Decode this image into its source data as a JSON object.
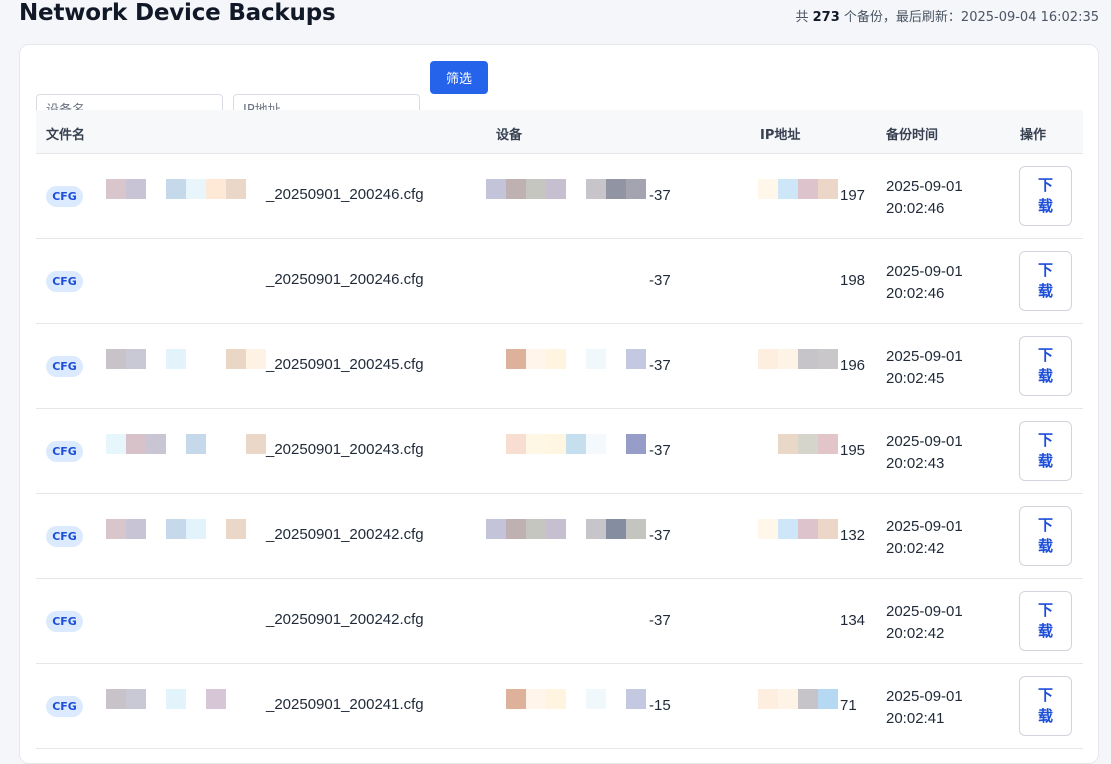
{
  "header": {
    "title": "Network Device Backups",
    "meta_prefix": "共",
    "total": "273",
    "meta_middle": "个备份，最后刷新：",
    "refreshed": "2025-09-04 16:02:35"
  },
  "filters": {
    "device_placeholder": "设备名",
    "ip_placeholder": "IP地址",
    "button_label": "筛选"
  },
  "table": {
    "columns": [
      "文件名",
      "设备",
      "IP地址",
      "备份时间",
      "操作"
    ],
    "rows": [
      {
        "tag": "CFG",
        "filename": "_20250901_200246.cfg",
        "device": "-37",
        "ip": "197",
        "time": [
          "2025-09-01",
          "20:02:46"
        ],
        "action": "下载"
      },
      {
        "tag": "CFG",
        "filename": "_20250901_200246.cfg",
        "device": "-37",
        "ip": "198",
        "time": [
          "2025-09-01",
          "20:02:46"
        ],
        "action": "下载"
      },
      {
        "tag": "CFG",
        "filename": "_20250901_200245.cfg",
        "device": "-37",
        "ip": "196",
        "time": [
          "2025-09-01",
          "20:02:45"
        ],
        "action": "下载"
      },
      {
        "tag": "CFG",
        "filename": "_20250901_200243.cfg",
        "device": "-37",
        "ip": "195",
        "time": [
          "2025-09-01",
          "20:02:43"
        ],
        "action": "下载"
      },
      {
        "tag": "CFG",
        "filename": "_20250901_200242.cfg",
        "device": "-37",
        "ip": "132",
        "time": [
          "2025-09-01",
          "20:02:42"
        ],
        "action": "下载"
      },
      {
        "tag": "CFG",
        "filename": "_20250901_200242.cfg",
        "device": "-37",
        "ip": "134",
        "time": [
          "2025-09-01",
          "20:02:42"
        ],
        "action": "下载"
      },
      {
        "tag": "CFG",
        "filename": "_20250901_200241.cfg",
        "device": "-15",
        "ip": "71",
        "time": [
          "2025-09-01",
          "20:02:41"
        ],
        "action": "下载"
      }
    ]
  },
  "colors": {
    "accent": "#2563eb",
    "tag_bg": "#dbeafe",
    "tag_text": "#1d4ed8"
  }
}
